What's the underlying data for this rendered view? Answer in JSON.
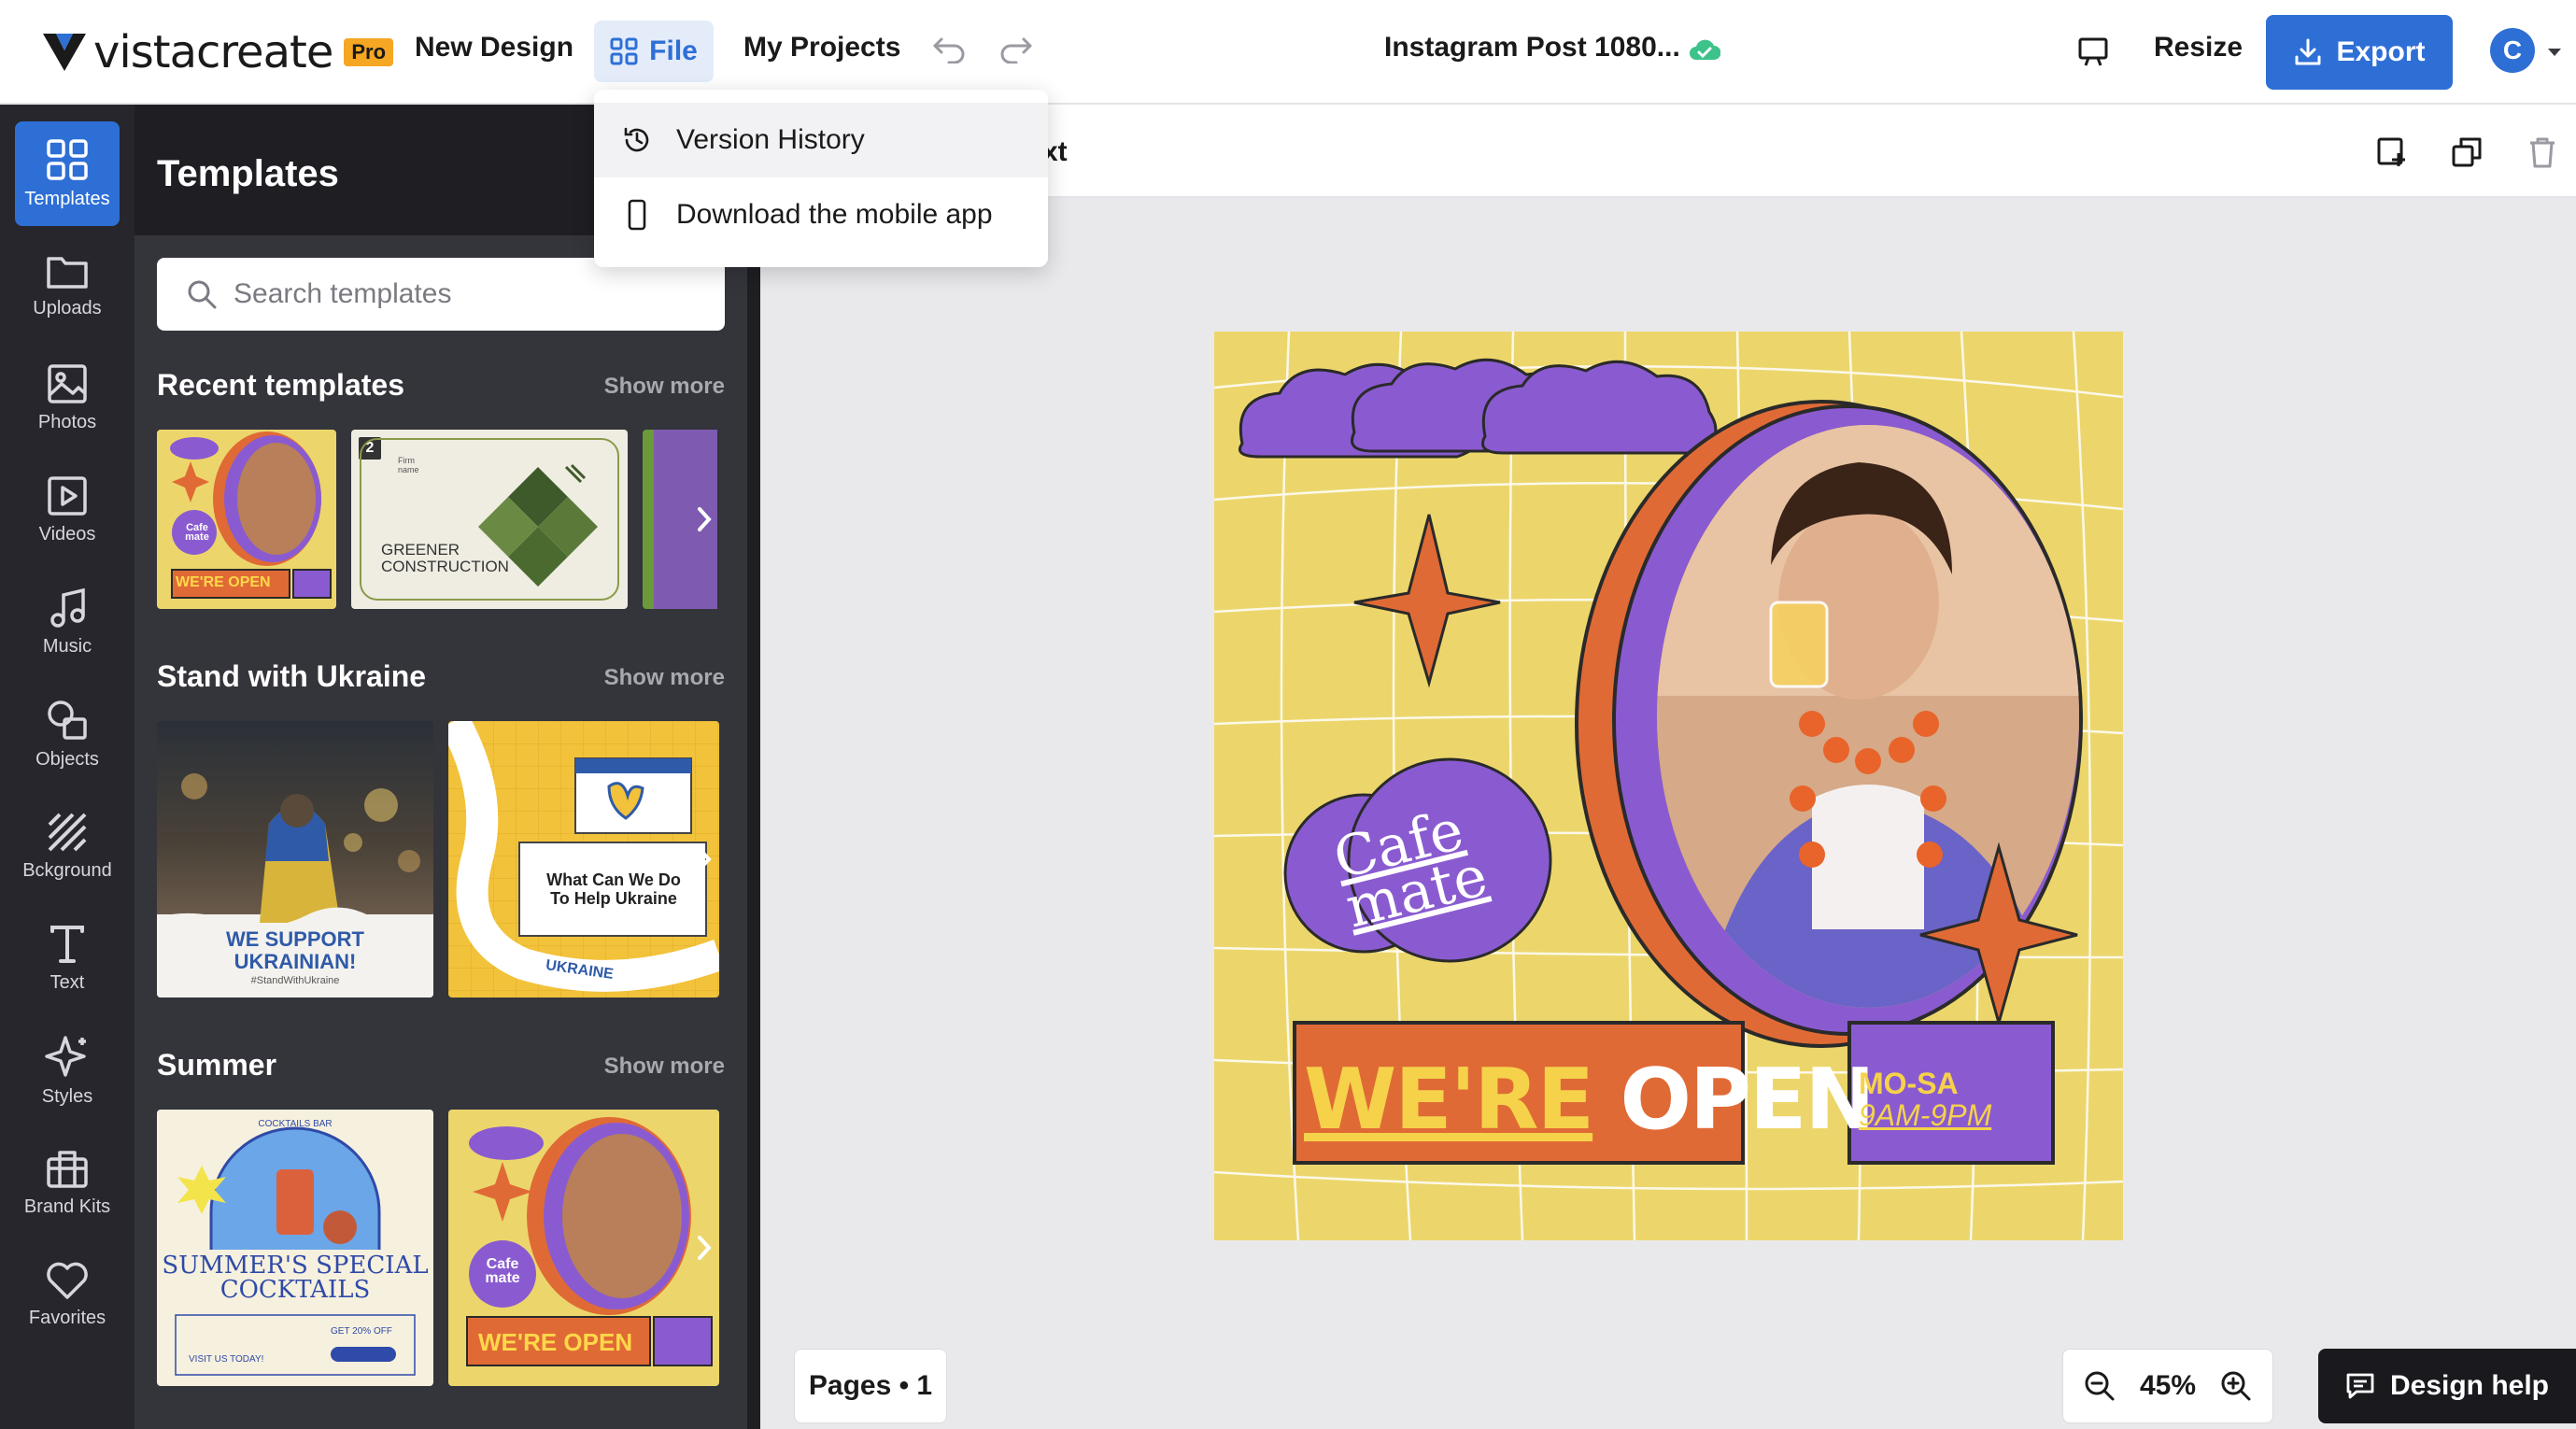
{
  "app": {
    "brand": "vistacreate",
    "badge": "Pro",
    "accent_color": "#2e6fd6"
  },
  "topbar": {
    "new_design": "New Design",
    "file": "File",
    "my_projects": "My Projects",
    "doc_title": "Instagram Post 1080...",
    "resize": "Resize",
    "export": "Export",
    "avatar_initial": "C"
  },
  "file_menu": {
    "items": [
      {
        "label": "Version History",
        "icon": "history-icon"
      },
      {
        "label": "Download the mobile app",
        "icon": "phone-icon"
      }
    ]
  },
  "rail": {
    "items": [
      {
        "label": "Templates",
        "icon": "grid-icon",
        "active": true
      },
      {
        "label": "Uploads",
        "icon": "folder-icon"
      },
      {
        "label": "Photos",
        "icon": "image-icon"
      },
      {
        "label": "Videos",
        "icon": "play-icon"
      },
      {
        "label": "Music",
        "icon": "music-icon"
      },
      {
        "label": "Objects",
        "icon": "shapes-icon"
      },
      {
        "label": "Bckground",
        "icon": "pattern-icon"
      },
      {
        "label": "Text",
        "icon": "text-icon"
      },
      {
        "label": "Styles",
        "icon": "sparkle-icon"
      },
      {
        "label": "Brand Kits",
        "icon": "briefcase-icon"
      },
      {
        "label": "Favorites",
        "icon": "heart-icon"
      }
    ]
  },
  "panel": {
    "title": "Templates",
    "search_placeholder": "Search templates",
    "sections": [
      {
        "title": "Recent templates",
        "show_more": "Show more"
      },
      {
        "title": "Stand with Ukraine",
        "show_more": "Show more"
      },
      {
        "title": "Summer",
        "show_more": "Show more"
      }
    ],
    "thumbs": {
      "cafe_small_cafe": "Cafe",
      "cafe_small_mate": "mate",
      "cafe_small_open": "WE'RE OPEN",
      "green_badge": "2",
      "green_firm": "Firm name",
      "green_title_1": "GREENER",
      "green_title_2": "CONSTRUCTION",
      "ukraine_1": "WE SUPPORT",
      "ukraine_2": "UKRAINIAN!",
      "ukraine_tag": "#StandWithUkraine",
      "ukraine_card_1": "What Can We Do",
      "ukraine_card_2": "To Help Ukraine",
      "ukraine_word": "UKRAINE",
      "cocktail_small": "COCKTAILS BAR",
      "cocktail_1": "SUMMER'S SPECIAL",
      "cocktail_2": "COCKTAILS",
      "cocktail_visit": "VISIT US TODAY!",
      "cocktail_get": "GET 20% OFF"
    }
  },
  "ctxbar": {
    "text_fragment": "xt"
  },
  "design": {
    "bg_color": "#ecd66b",
    "purple": "#8a5bd0",
    "orange": "#e06a35",
    "cafe": "Cafe",
    "mate": "mate",
    "open_1": "WE'RE",
    "open_2": "OPEN",
    "hours_1": "MO-SA",
    "hours_2": "9AM-9PM"
  },
  "bottom": {
    "pages": "Pages • 1",
    "zoom": "45%",
    "help": "Design help"
  }
}
